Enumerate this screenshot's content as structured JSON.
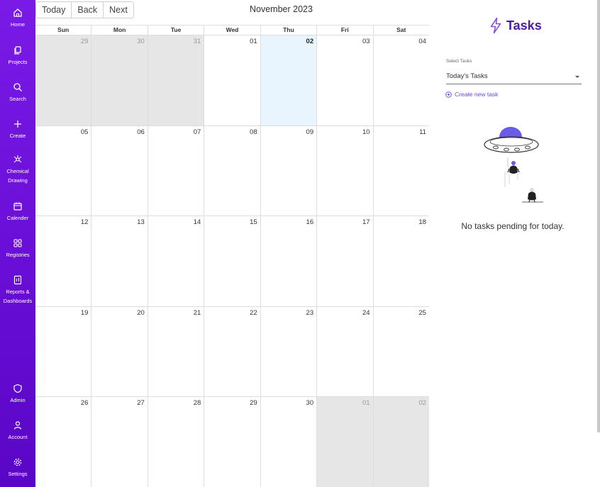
{
  "sidebar": {
    "items": [
      {
        "label": "Home",
        "icon": "home-icon"
      },
      {
        "label": "Projects",
        "icon": "projects-icon"
      },
      {
        "label": "Search",
        "icon": "search-icon"
      },
      {
        "label": "Create",
        "icon": "plus-icon"
      },
      {
        "label": "Chemical\nDrawing",
        "icon": "molecule-icon"
      },
      {
        "label": "Calender",
        "icon": "calendar-icon"
      },
      {
        "label": "Registries",
        "icon": "grid-icon"
      },
      {
        "label": "Reports &\nDashboards",
        "icon": "report-icon"
      },
      {
        "label": "Admin",
        "icon": "shield-icon"
      },
      {
        "label": "Account",
        "icon": "user-icon"
      },
      {
        "label": "Settings",
        "icon": "gear-icon"
      }
    ]
  },
  "toolbar": {
    "today": "Today",
    "back": "Back",
    "next": "Next"
  },
  "calendar": {
    "title": "November 2023",
    "weekdays": [
      "Sun",
      "Mon",
      "Tue",
      "Wed",
      "Thu",
      "Fri",
      "Sat"
    ],
    "weeks": [
      [
        "29",
        "30",
        "31",
        "01",
        "02",
        "03",
        "04"
      ],
      [
        "05",
        "06",
        "07",
        "08",
        "09",
        "10",
        "11"
      ],
      [
        "12",
        "13",
        "14",
        "15",
        "16",
        "17",
        "18"
      ],
      [
        "19",
        "20",
        "21",
        "22",
        "23",
        "24",
        "25"
      ],
      [
        "26",
        "27",
        "28",
        "29",
        "30",
        "01",
        "02"
      ]
    ]
  },
  "tasks": {
    "title": "Tasks",
    "select_label": "Select Tasks",
    "select_value": "Today's Tasks",
    "create_link": "Create new task",
    "empty_message": "No tasks pending for today."
  },
  "colors": {
    "sidebar": "#6a0fd8",
    "accent": "#4b1aa8",
    "link": "#6c47d8",
    "today_bg": "#e8f4fe",
    "off_day_bg": "#e6e6e6"
  }
}
